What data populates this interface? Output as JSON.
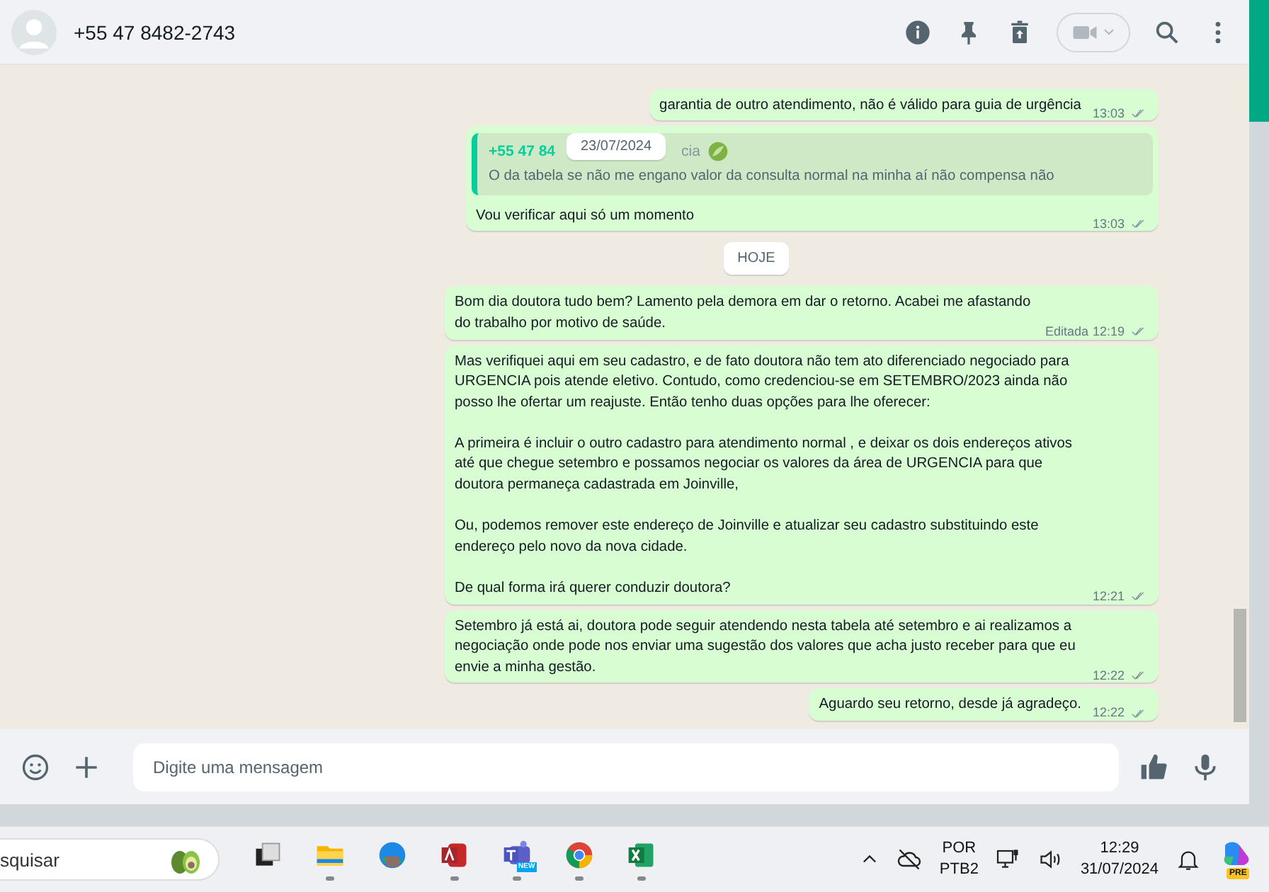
{
  "header": {
    "contact": "+55 47 8482-2743"
  },
  "floating_date": "23/07/2024",
  "messages": [
    {
      "kind": "out",
      "text": "garantia de outro atendimento, não é válido para guia de urgência",
      "time": "13:03",
      "read": true
    },
    {
      "kind": "quote",
      "quote_author": "+55 47 84",
      "quote_suffix": "cia",
      "quote_text": "O da tabela se não me engano valor da consulta normal na minha aí não compensa não",
      "text": "Vou verificar aqui só um momento",
      "time": "13:03",
      "read": true
    },
    {
      "kind": "date",
      "text": "HOJE"
    },
    {
      "kind": "out",
      "text": "Bom dia doutora tudo bem? Lamento pela demora em dar o retorno. Acabei me afastando do trabalho por motivo de saúde.",
      "edited": "Editada",
      "time": "12:19",
      "read": true
    },
    {
      "kind": "out",
      "text": "Mas verifiquei aqui em seu cadastro, e de fato doutora não tem ato diferenciado negociado para URGENCIA pois atende eletivo. Contudo, como credenciou-se em SETEMBRO/2023 ainda não posso lhe ofertar um reajuste. Então tenho duas opções para lhe oferecer:\n\nA primeira é incluir o outro cadastro para atendimento normal , e deixar os dois endereços ativos até que chegue setembro e possamos negociar os valores da área de URGENCIA para que doutora permaneça cadastrada em Joinville,\n\nOu, podemos remover este endereço de Joinville e atualizar seu cadastro substituindo este endereço pelo novo da nova cidade.\n\nDe qual forma irá querer conduzir doutora?",
      "time": "12:21",
      "read": true
    },
    {
      "kind": "out",
      "text": "Setembro já está ai, doutora pode seguir atendendo nesta tabela até setembro e ai realizamos a negociação onde pode nos enviar uma sugestão dos valores que acha justo receber para que eu envie a minha gestão.",
      "time": "12:22",
      "read": true
    },
    {
      "kind": "out",
      "text": "Aguardo seu retorno, desde já agradeço.",
      "time": "12:22",
      "read": true
    }
  ],
  "composer": {
    "placeholder": "Digite uma mensagem"
  },
  "taskbar": {
    "search": "squisar",
    "language": "POR",
    "layout": "PTB2",
    "time": "12:29",
    "date": "31/07/2024",
    "copilot_badge": "PRE",
    "teams_badge": "NEW"
  }
}
